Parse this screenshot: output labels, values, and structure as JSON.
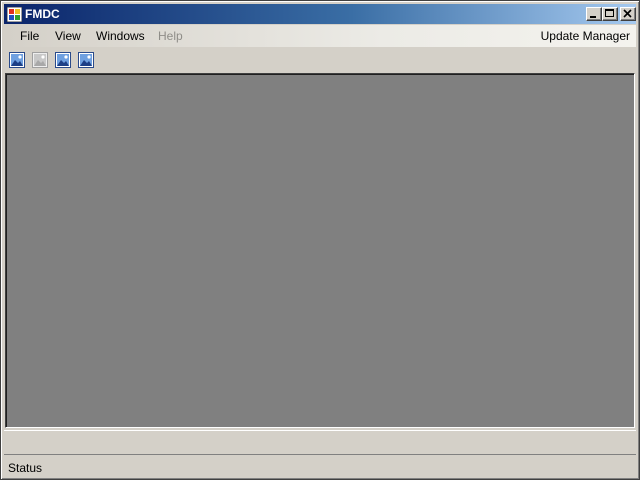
{
  "window": {
    "title": "FMDC",
    "caption_buttons": [
      "minimize-icon",
      "maximize-icon",
      "close-icon"
    ]
  },
  "menubar": {
    "items": [
      {
        "label": "File",
        "enabled": true
      },
      {
        "label": "View",
        "enabled": true
      },
      {
        "label": "Windows",
        "enabled": true
      },
      {
        "label": "Help",
        "enabled": false
      }
    ],
    "right_item": {
      "label": "Update Manager",
      "enabled": true
    }
  },
  "toolbar": {
    "buttons": [
      {
        "icon": "picture-icon",
        "enabled": true
      },
      {
        "icon": "picture-icon",
        "enabled": false
      },
      {
        "icon": "picture-icon",
        "enabled": true
      },
      {
        "icon": "picture-icon",
        "enabled": true
      }
    ]
  },
  "statusbar": {
    "text": "Status"
  },
  "colors": {
    "title_gradient_start": "#0a246a",
    "title_gradient_end": "#a6caf0",
    "face": "#d4d0c8",
    "mdi_background": "#808080"
  }
}
